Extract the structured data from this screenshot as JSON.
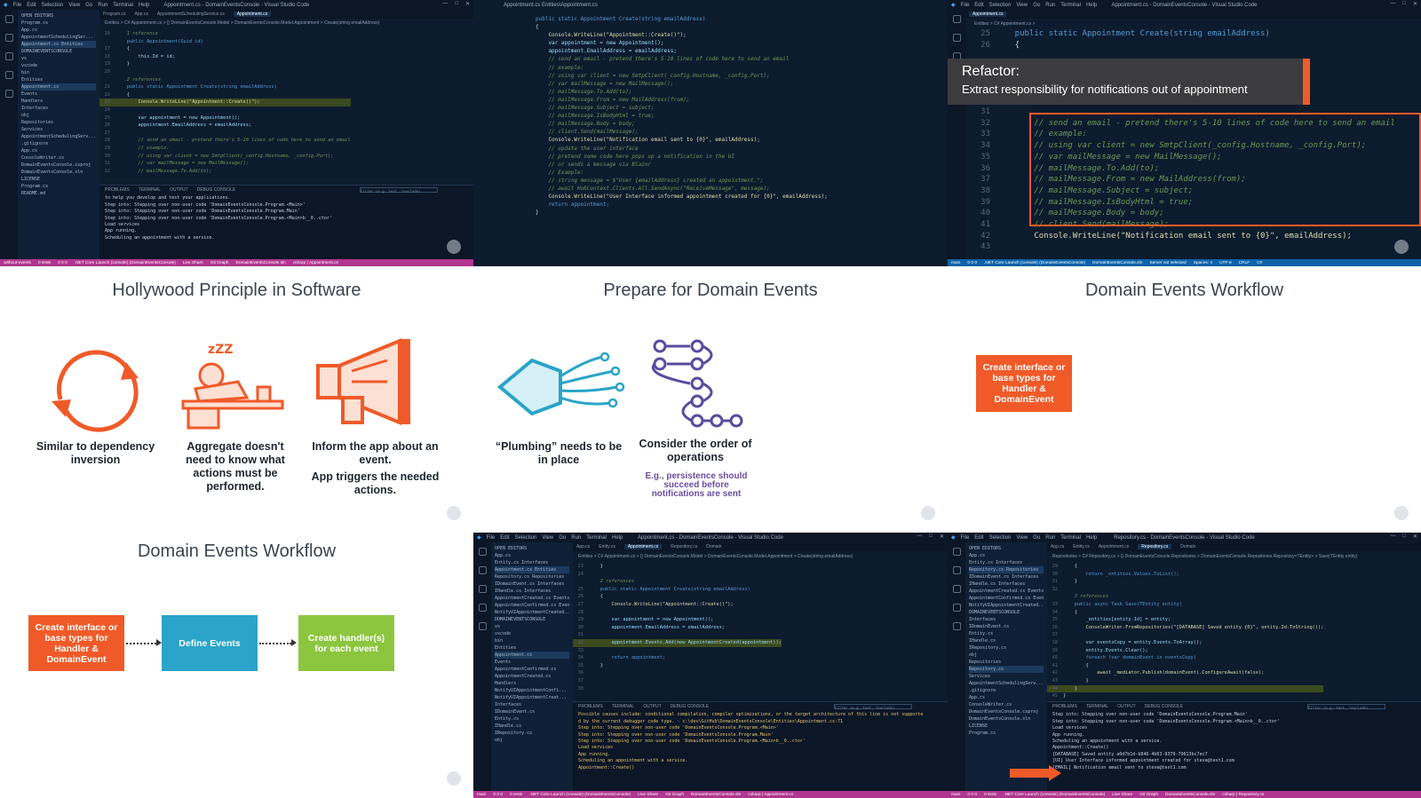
{
  "colors": {
    "accent_orange": "#f05a28",
    "box_blue": "#2aa4c8",
    "box_green": "#8cc63f",
    "vscode_bg": "#0d1b2e",
    "status_purple": "#b0368f",
    "status_blue": "#0e62a8",
    "purple_note": "#6a4fa0"
  },
  "panel1": {
    "menu": [
      "File",
      "Edit",
      "Selection",
      "View",
      "Go",
      "Run",
      "Terminal",
      "Help"
    ],
    "window_title": "Appointment.cs - DomainEventsConsole - Visual Studio Code",
    "tabs": [
      "Program.cs",
      "App.cs",
      "AppointmentSchedulingService.cs",
      "Appointment.cs"
    ],
    "breadcrumb": "Entities > C# Appointment.cs > {} DomainEventsConsole.Model > DomainEventsConsole.Model.Appointment > Create(string emailAddress)",
    "explorer": [
      "OPEN EDITORS",
      "Program.cs",
      "App.cs",
      "AppointmentSchedulingSer...",
      "Appointment.cs Entities",
      "DOMAINEVENTSCONSOLE",
      "vs",
      "vscode",
      "bin",
      "Entities",
      "Appointment.cs",
      "Events",
      "Handlers",
      "Interfaces",
      "obj",
      "Repositories",
      "Services",
      "AppointmentSchedulingServ...",
      ".gitignore",
      "App.cs",
      "ConsoleWriter.cs",
      "DomainEventsConsole.csproj",
      "DomainEventsConsole.sln",
      "LICENSE",
      "Program.cs",
      "README.md"
    ],
    "code": [
      {
        "n": "16",
        "t": "    1 reference",
        "c": "cm"
      },
      {
        "n": "",
        "t": "    public Appointment(Guid id)",
        "c": "kw"
      },
      {
        "n": "17",
        "t": "    {",
        "c": ""
      },
      {
        "n": "18",
        "t": "        this.Id = id;",
        "c": "id"
      },
      {
        "n": "19",
        "t": "    }",
        "c": ""
      },
      {
        "n": "20",
        "t": "",
        "c": ""
      },
      {
        "n": "",
        "t": "    2 references",
        "c": "cm"
      },
      {
        "n": "21",
        "t": "    public static Appointment Create(string emailAddress)",
        "c": "kw"
      },
      {
        "n": "22",
        "t": "    {",
        "c": ""
      },
      {
        "n": "23",
        "t": "        Console.WriteLine(\"Appointment::Create()\");",
        "c": "fn",
        "hl": true
      },
      {
        "n": "24",
        "t": "",
        "c": ""
      },
      {
        "n": "25",
        "t": "        var appointment = new Appointment();",
        "c": "id"
      },
      {
        "n": "26",
        "t": "        appointment.EmailAddress = emailAddress;",
        "c": "id"
      },
      {
        "n": "27",
        "t": "",
        "c": ""
      },
      {
        "n": "28",
        "t": "        // send an email - pretend there's 5-10 lines of code here to send an email",
        "c": "cm"
      },
      {
        "n": "29",
        "t": "        // example:",
        "c": "cm"
      },
      {
        "n": "30",
        "t": "        // using var client = new SmtpClient(_config.Hostname, _config.Port);",
        "c": "cm"
      },
      {
        "n": "31",
        "t": "        // var mailMessage = new MailMessage();",
        "c": "cm"
      },
      {
        "n": "32",
        "t": "        // mailMessage.To.Add(to);",
        "c": "cm"
      }
    ],
    "panel_tabs": [
      "PROBLEMS",
      "TERMINAL",
      "OUTPUT",
      "DEBUG CONSOLE"
    ],
    "filter_placeholder": "Filter (e.g. text, !exclude)",
    "terminal_intro": "to help you develop and test your applications.",
    "terminal": [
      "Step into: Stepping over non-user code 'DomainEventsConsole.Program.<Main>'",
      "Step into: Stepping over non-user code 'DomainEventsConsole.Program.Main'",
      "Step into: Stepping over non-user code 'DomainEventsConsole.Program.<Main>b__0..ctor'",
      "Load services",
      "App running.",
      "Scheduling an appointment with a service."
    ],
    "status": [
      "without-events",
      "0 tests",
      "0 0 0",
      ".NET Core Launch (console) (DomainEventsConsole)",
      "Live Share",
      "Git Graph",
      "DomainEventsConsole.sln",
      "csharp | Appointment.cs"
    ]
  },
  "panel2": {
    "window_title": "Appointment.cs  Entities\\Appointment.cs",
    "code": [
      {
        "t": "public static Appointment Create(string emailAddress)",
        "c": "kw"
      },
      {
        "t": "{",
        "c": ""
      },
      {
        "t": "    Console.WriteLine(\"Appointment::Create()\");",
        "c": "fn"
      },
      {
        "t": "",
        "c": ""
      },
      {
        "t": "    var appointment = new Appointment();",
        "c": "id"
      },
      {
        "t": "    appointment.EmailAddress = emailAddress;",
        "c": "id"
      },
      {
        "t": "",
        "c": ""
      },
      {
        "t": "    // send an email - pretend there's 5-10 lines of code here to send an email",
        "c": "cm"
      },
      {
        "t": "    // example:",
        "c": "cm"
      },
      {
        "t": "    // using var client = new SmtpClient(_config.Hostname, _config.Port);",
        "c": "cm"
      },
      {
        "t": "    // var mailMessage = new MailMessage();",
        "c": "cm"
      },
      {
        "t": "    // mailMessage.To.Add(to);",
        "c": "cm"
      },
      {
        "t": "    // mailMessage.From = new MailAddress(from);",
        "c": "cm"
      },
      {
        "t": "    // mailMessage.Subject = subject;",
        "c": "cm"
      },
      {
        "t": "    // mailMessage.IsBodyHtml = true;",
        "c": "cm"
      },
      {
        "t": "    // mailMessage.Body = body;",
        "c": "cm"
      },
      {
        "t": "    // client.Send(mailMessage);",
        "c": "cm"
      },
      {
        "t": "    Console.WriteLine(\"Notification email sent to {0}\", emailAddress);",
        "c": "fn"
      },
      {
        "t": "",
        "c": ""
      },
      {
        "t": "    // update the user interface",
        "c": "cm"
      },
      {
        "t": "    // pretend some code here pops up a notification in the UI",
        "c": "cm"
      },
      {
        "t": "    // or sends a message via Blazor",
        "c": "cm"
      },
      {
        "t": "    // Example:",
        "c": "cm"
      },
      {
        "t": "    // string message = $\"User {emailAddress} created an appointment.\";",
        "c": "cm"
      },
      {
        "t": "    // await HubContext.Clients.All.SendAsync(\"ReceiveMessage\", message);",
        "c": "cm"
      },
      {
        "t": "    Console.WriteLine(\"User Interface informed appointment created for {0}\", emailAddress);",
        "c": "fn"
      },
      {
        "t": "",
        "c": ""
      },
      {
        "t": "    return appointment;",
        "c": "kw"
      },
      {
        "t": "}",
        "c": ""
      }
    ]
  },
  "panel3": {
    "menu": [
      "File",
      "Edit",
      "Selection",
      "View",
      "Go",
      "Run",
      "Terminal",
      "Help"
    ],
    "window_title": "Appointment.cs - DomainEventsConsole - Visual Studio Code",
    "tab": "Appointment.cs",
    "breadcrumb": "Entities > C# Appointment.cs >",
    "refactor_title": "Refactor:",
    "refactor_sub": "Extract responsibility for notifications out of appointment",
    "code_top": [
      {
        "n": "25",
        "t": "    public static Appointment Create(string emailAddress)",
        "c": "kw"
      },
      {
        "n": "26",
        "t": "    {",
        "c": ""
      }
    ],
    "code": [
      {
        "n": "31",
        "t": "",
        "c": ""
      },
      {
        "n": "32",
        "t": "        // send an email - pretend there's 5-10 lines of code here to send an email",
        "c": "cm"
      },
      {
        "n": "33",
        "t": "        // example:",
        "c": "cm"
      },
      {
        "n": "34",
        "t": "        // using var client = new SmtpClient(_config.Hostname, _config.Port);",
        "c": "cm"
      },
      {
        "n": "35",
        "t": "        // var mailMessage = new MailMessage();",
        "c": "cm"
      },
      {
        "n": "36",
        "t": "        // mailMessage.To.Add(to);",
        "c": "cm"
      },
      {
        "n": "37",
        "t": "        // mailMessage.From = new MailAddress(from);",
        "c": "cm"
      },
      {
        "n": "38",
        "t": "        // mailMessage.Subject = subject;",
        "c": "cm"
      },
      {
        "n": "39",
        "t": "        // mailMessage.IsBodyHtml = true;",
        "c": "cm"
      },
      {
        "n": "40",
        "t": "        // mailMessage.Body = body;",
        "c": "cm"
      },
      {
        "n": "41",
        "t": "        // client.Send(mailMessage);",
        "c": "cm"
      },
      {
        "n": "42",
        "t": "        Console.WriteLine(\"Notification email sent to {0}\", emailAddress);",
        "c": "fn"
      },
      {
        "n": "43",
        "t": "",
        "c": ""
      }
    ],
    "status": [
      "main",
      "0 0 0",
      ".NET Core Launch (console) (DomainEventsConsole)",
      "DomainEventsConsole.sln",
      "Server not selected",
      "Spaces: 4",
      "UTF-8",
      "CRLF",
      "C#"
    ]
  },
  "slide4": {
    "title": "Hollywood Principle in Software",
    "items": [
      {
        "caption": "Similar to dependency inversion",
        "sub": ""
      },
      {
        "caption": "Aggregate doesn't need to know what actions must be performed.",
        "sub": ""
      },
      {
        "caption": "Inform the app about an event.",
        "sub": "App triggers the needed actions."
      }
    ]
  },
  "slide5": {
    "title": "Prepare for Domain Events",
    "items": [
      {
        "caption": "“Plumbing” needs to be in place",
        "note": ""
      },
      {
        "caption": "Consider the order of operations",
        "note": "E.g., persistence should succeed before notifications are sent"
      }
    ]
  },
  "slide6": {
    "title": "Domain Events Workflow",
    "box1": "Create interface or base types for Handler & DomainEvent"
  },
  "slide7": {
    "title": "Domain Events Workflow",
    "box1": "Create interface or base types for Handler & DomainEvent",
    "box2": "Define Events",
    "box3": "Create handler(s) for each event"
  },
  "panel8": {
    "menu": [
      "File",
      "Edit",
      "Selection",
      "View",
      "Go",
      "Run",
      "Terminal",
      "Help"
    ],
    "window_title": "Appointment.cs - DomainEventsConsole - Visual Studio Code",
    "tabs": [
      "App.cs",
      "Entity.cs",
      "Appointment.cs",
      "Repository.cs",
      "Domain"
    ],
    "breadcrumb": "Entities > C# Appointment.cs > {} DomainEventsConsole.Model > DomainEventsConsole.Model.Appointment > Create(string emailAddress)",
    "explorer": [
      "OPEN EDITORS",
      "App.cs",
      "Entity.cs Interfaces",
      "Appointment.cs Entities",
      "Repository.cs Repositories",
      "IDomainEvent.cs Interfaces",
      "IHandle.cs Interfaces",
      "AppointmentCreated.cs Events",
      "AppointmentConfirmed.cs Events",
      "NotifyUIAppointmentCreated...",
      "DOMAINEVENTSCONSOLE",
      "vs",
      "vscode",
      "bin",
      "Entities",
      "Appointment.cs",
      "Events",
      "AppointmentConfirmed.cs",
      "AppointmentCreated.cs",
      "Handlers",
      "NotifyUIAppointmentConfi...",
      "NotifyUIAppointmentCreat...",
      "Interfaces",
      "IDomainEvent.cs",
      "Entity.cs",
      "IHandle.cs",
      "IRepository.cs",
      "obj"
    ],
    "code": [
      {
        "n": "23",
        "t": "    }",
        "c": ""
      },
      {
        "n": "24",
        "t": "",
        "c": ""
      },
      {
        "n": "",
        "t": "    2 references",
        "c": "cm"
      },
      {
        "n": "25",
        "t": "    public static Appointment Create(string emailAddress)",
        "c": "kw"
      },
      {
        "n": "26",
        "t": "    {",
        "c": ""
      },
      {
        "n": "27",
        "t": "        Console.WriteLine(\"Appointment::Create()\");",
        "c": "fn"
      },
      {
        "n": "28",
        "t": "",
        "c": ""
      },
      {
        "n": "29",
        "t": "        var appointment = new Appointment();",
        "c": "id"
      },
      {
        "n": "30",
        "t": "        appointment.EmailAddress = emailAddress;",
        "c": "id"
      },
      {
        "n": "31",
        "t": "",
        "c": ""
      },
      {
        "n": "32",
        "t": "        appointment.Events.Add(new AppointmentCreated(appointment));",
        "c": "id",
        "hl": true
      },
      {
        "n": "33",
        "t": "",
        "c": ""
      },
      {
        "n": "34",
        "t": "        return appointment;",
        "c": "kw"
      },
      {
        "n": "35",
        "t": "    }",
        "c": ""
      },
      {
        "n": "36",
        "t": "",
        "c": ""
      },
      {
        "n": "37",
        "t": "",
        "c": ""
      },
      {
        "n": "38",
        "t": "",
        "c": ""
      }
    ],
    "panel_tabs": [
      "PROBLEMS",
      "TERMINAL",
      "OUTPUT",
      "DEBUG CONSOLE"
    ],
    "filter_placeholder": "Filter (e.g. text, !exclude)",
    "terminal": [
      "Possible causes include: conditional compilation, compiler optimizations, or the target architecture of this line is not supporte",
      "d by the current debugger code type.  - c:\\dev\\GitHub\\DomainEventsConsole\\Entities\\Appointment.cs:71",
      "Step into: Stepping over non-user code 'DomainEventsConsole.Program.<Main>'",
      "Step into: Stepping over non-user code 'DomainEventsConsole.Program.Main'",
      "Step into: Stepping over non-user code 'DomainEventsConsole.Program.<Main>b__0..ctor'",
      "Load services",
      "App running.",
      "Scheduling an appointment with a service.",
      "Appointment::Create()"
    ],
    "status": [
      "main",
      "0 0 0",
      "0 tests",
      ".NET Core Launch (console) (DomainEventsConsole)",
      "Live Share",
      "Git Graph",
      "DomainEventsConsole.sln",
      "csharp | Appointment.cs"
    ]
  },
  "panel9": {
    "menu": [
      "File",
      "Edit",
      "Selection",
      "View",
      "Go",
      "Run",
      "Terminal",
      "Help"
    ],
    "window_title": "Repository.cs - DomainEventsConsole - Visual Studio Code",
    "tabs": [
      "App.cs",
      "Entity.cs",
      "Appointment.cs",
      "Repository.cs",
      "Domain"
    ],
    "breadcrumb": "Repositories > C# Repository.cs > {} DomainEventsConsole.Repositories > DomainEventsConsole.Repositories.Repository<TEntity> > Save(TEntity entity)",
    "explorer": [
      "OPEN EDITORS",
      "App.cs",
      "Entity.cs Interfaces",
      "Repository.cs Repositories",
      "IDomainEvent.cs Interfaces",
      "IHandle.cs Interfaces",
      "AppointmentCreated.cs Events",
      "AppointmentConfirmed.cs Events",
      "NotifyUIAppointmentCreated...",
      "DOMAINEVENTSCONSOLE",
      "Interfaces",
      "IDomainEvent.cs",
      "Entity.cs",
      "IHandle.cs",
      "IRepository.cs",
      "obj",
      "Repositories",
      "Repository.cs",
      "Services",
      "AppointmentSchedulingServ...",
      ".gitignore",
      "App.cs",
      "ConsoleWriter.cs",
      "DomainEventsConsole.csproj",
      "DomainEventsConsole.sln",
      "LICENSE",
      "Program.cs"
    ],
    "code": [
      {
        "n": "29",
        "t": "    {",
        "c": ""
      },
      {
        "n": "30",
        "t": "        return _entities.Values.ToList();",
        "c": "kw"
      },
      {
        "n": "31",
        "t": "    }",
        "c": ""
      },
      {
        "n": "32",
        "t": "",
        "c": ""
      },
      {
        "n": "",
        "t": "    3 references",
        "c": "cm"
      },
      {
        "n": "33",
        "t": "    public async Task Save(TEntity entity)",
        "c": "kw"
      },
      {
        "n": "34",
        "t": "    {",
        "c": ""
      },
      {
        "n": "35",
        "t": "        _entities[entity.Id] = entity;",
        "c": "id"
      },
      {
        "n": "36",
        "t": "        ConsoleWriter.FromRepositories(\"[DATABASE] Saved entity {0}\", entity.Id.ToString());",
        "c": "fn"
      },
      {
        "n": "37",
        "t": "",
        "c": ""
      },
      {
        "n": "38",
        "t": "        var eventsCopy = entity.Events.ToArray();",
        "c": "id"
      },
      {
        "n": "39",
        "t": "        entity.Events.Clear();",
        "c": "id"
      },
      {
        "n": "40",
        "t": "        foreach (var domainEvent in eventsCopy)",
        "c": "kw"
      },
      {
        "n": "41",
        "t": "        {",
        "c": ""
      },
      {
        "n": "42",
        "t": "            await _mediator.Publish(domainEvent).ConfigureAwait(false);",
        "c": "fn"
      },
      {
        "n": "43",
        "t": "        }",
        "c": ""
      },
      {
        "n": "44",
        "t": "    }",
        "c": "",
        "hl": true
      },
      {
        "n": "45",
        "t": "}",
        "c": ""
      }
    ],
    "panel_tabs": [
      "PROBLEMS",
      "TERMINAL",
      "OUTPUT",
      "DEBUG CONSOLE"
    ],
    "filter_placeholder": "Filter (e.g. text, !exclude)",
    "terminal": [
      "Step into: Stepping over non-user code 'DomainEventsConsole.Program.Main'",
      "Step into: Stepping over non-user code 'DomainEventsConsole.Program.<Main>b__0..ctor'",
      "Load services",
      "App running.",
      "Scheduling an appointment with a service.",
      "Appointment::Create()",
      "[DATABASE] Saved entity a0d7b1d-b846-4b63-8379-79613bc7ec7",
      "[UI] User Interface informed appointment created for steve@test1.com",
      "[EMAIL] Notification email sent to steve@test1.com"
    ],
    "status": [
      "main",
      "0 0 0",
      "0 tests",
      ".NET Core Launch (console) (DomainEventsConsole)",
      "Live Share",
      "Git Graph",
      "DomainEventsConsole.sln",
      "csharp | Repository.cs"
    ]
  }
}
